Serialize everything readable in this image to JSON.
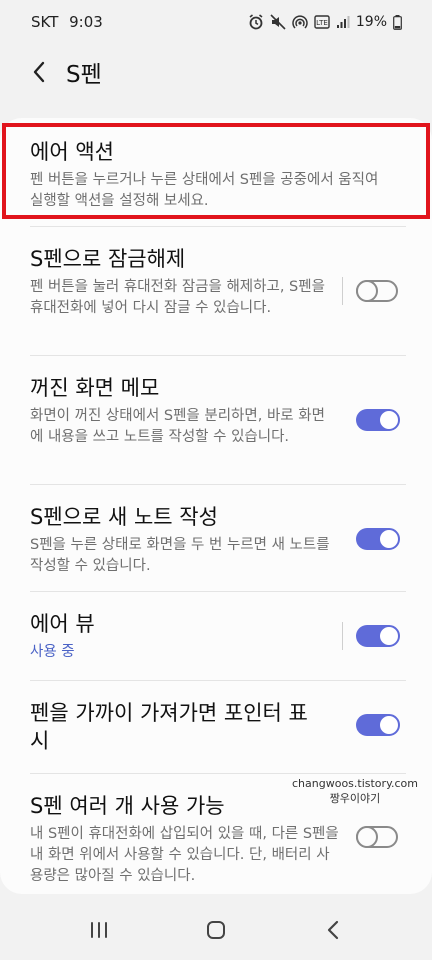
{
  "status_bar": {
    "carrier": "SKT",
    "time": "9:03",
    "battery": "19%",
    "icons": [
      "alarm-icon",
      "mute-icon",
      "hotspot-icon",
      "volte-icon",
      "signal-icon",
      "battery-icon"
    ]
  },
  "header": {
    "title": "S펜"
  },
  "settings": {
    "air_action": {
      "title": "에어 액션",
      "desc": "펜 버튼을 누르거나 누른 상태에서 S펜을 공중에서 움직여 실행할 액션을 설정해 보세요."
    },
    "unlock": {
      "title": "S펜으로 잠금해제",
      "desc": "펜 버튼을 눌러 휴대전화 잠금을 해제하고, S펜을 휴대전화에 넣어 다시 잠글 수 있습니다.",
      "enabled": false
    },
    "screen_off_memo": {
      "title": "꺼진 화면 메모",
      "desc": "화면이 꺼진 상태에서 S펜을 분리하면, 바로 화면에 내용을 쓰고 노트를 작성할 수 있습니다.",
      "enabled": true
    },
    "new_note": {
      "title": "S펜으로 새 노트 작성",
      "desc": "S펜을 누른 상태로 화면을 두 번 누르면 새 노트를 작성할 수 있습니다.",
      "enabled": true
    },
    "air_view": {
      "title": "에어 뷰",
      "status": "사용 중",
      "enabled": true
    },
    "pointer": {
      "title": "펜을 가까이 가져가면 포인터 표시",
      "enabled": true
    },
    "multi_pen": {
      "title": "S펜 여러 개 사용 가능",
      "desc": "내 S펜이 휴대전화에 삽입되어 있을 때, 다른 S펜을 내 화면 위에서 사용할 수 있습니다. 단, 배터리 사용량은 많아질 수 있습니다.",
      "enabled": false
    }
  },
  "watermark": {
    "line1": "changwoos.tistory.com",
    "line2": "짱우이야기"
  },
  "colors": {
    "toggle_on": "#5f6bd9",
    "toggle_off": "#8a8a8a",
    "highlight": "#e1141c",
    "status_text": "#4b63c6"
  },
  "nav": {
    "icons": [
      "recents-icon",
      "home-icon",
      "back-icon"
    ]
  }
}
